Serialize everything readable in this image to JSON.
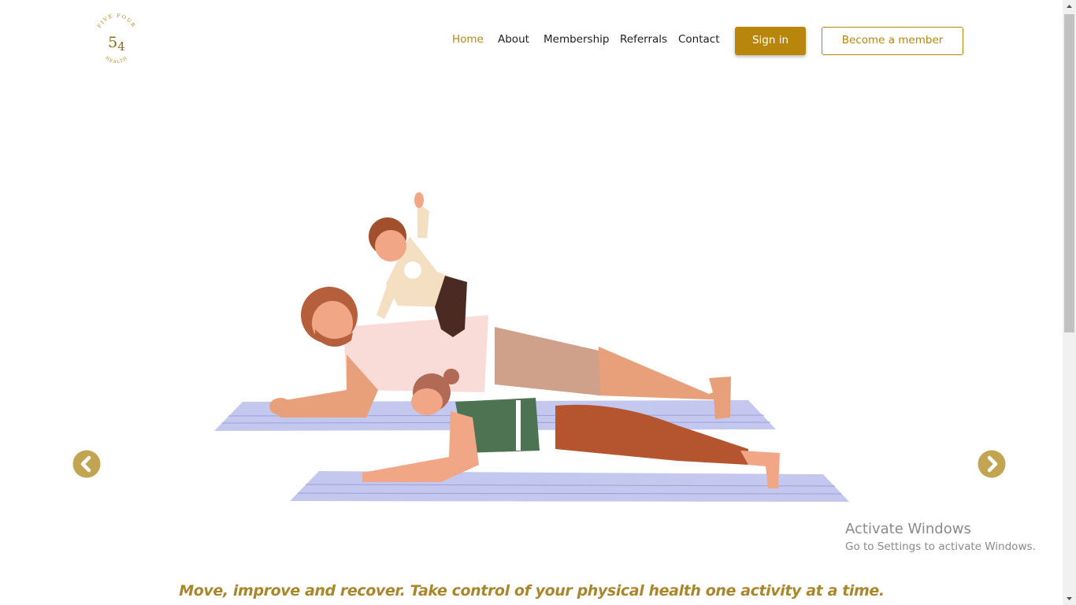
{
  "logo": {
    "top_text": "FIVE FOUR",
    "numeral": "54",
    "bottom_text": "HEALTH"
  },
  "nav": {
    "items": [
      {
        "label": "Home",
        "active": true
      },
      {
        "label": "About",
        "active": false
      },
      {
        "label": "Membership",
        "active": false
      },
      {
        "label": "Referrals",
        "active": false
      },
      {
        "label": "Contact",
        "active": false
      }
    ],
    "sign_in": "Sign in",
    "become_member": "Become a member"
  },
  "carousel": {
    "prev_icon": "chevron-left-circle-icon",
    "next_icon": "chevron-right-circle-icon"
  },
  "os_watermark": {
    "title": "Activate Windows",
    "subtitle": "Go to Settings to activate Windows."
  },
  "tagline": "Move, improve and recover. Take control of your physical health one activity at a time.",
  "colors": {
    "accent": "#b8860b",
    "tagline": "#a8862c",
    "nav_text": "#1f1f1f",
    "arrow": "#c2a553"
  }
}
